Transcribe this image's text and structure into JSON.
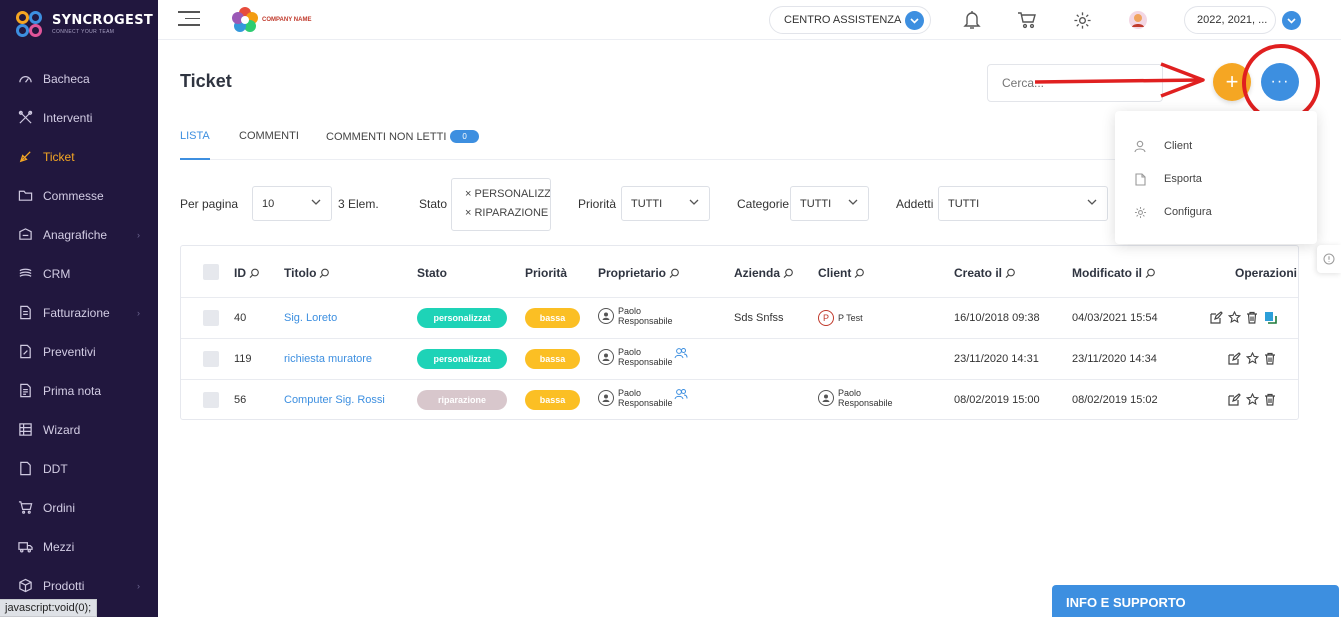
{
  "brand": {
    "name": "SYNCROGEST",
    "tagline": "CONNECT YOUR TEAM"
  },
  "sidebar": {
    "items": [
      {
        "label": "Bacheca",
        "icon": "gauge-icon"
      },
      {
        "label": "Interventi",
        "icon": "tools-icon"
      },
      {
        "label": "Ticket",
        "icon": "ticket-icon",
        "active": true
      },
      {
        "label": "Commesse",
        "icon": "folder-icon"
      },
      {
        "label": "Anagrafiche",
        "icon": "contacts-icon",
        "has_sub": true
      },
      {
        "label": "CRM",
        "icon": "crm-icon"
      },
      {
        "label": "Fatturazione",
        "icon": "invoice-icon",
        "has_sub": true
      },
      {
        "label": "Preventivi",
        "icon": "quote-icon"
      },
      {
        "label": "Prima nota",
        "icon": "notes-icon"
      },
      {
        "label": "Wizard",
        "icon": "wizard-icon"
      },
      {
        "label": "DDT",
        "icon": "ddt-icon"
      },
      {
        "label": "Ordini",
        "icon": "cart-icon"
      },
      {
        "label": "Mezzi",
        "icon": "truck-icon"
      },
      {
        "label": "Prodotti",
        "icon": "product-icon",
        "has_sub": true
      }
    ]
  },
  "statusbar": "javascript:void(0);",
  "topbar": {
    "company_logo_text": "COMPANY NAME",
    "assistance_label": "CENTRO ASSISTENZA",
    "year_label": "2022, 2021, ..."
  },
  "page": {
    "title": "Ticket",
    "search_placeholder": "Cerca...",
    "add_button": "+",
    "more_button": "···"
  },
  "tabs": [
    {
      "label": "LISTA",
      "active": true
    },
    {
      "label": "COMMENTI"
    },
    {
      "label": "COMMENTI NON LETTI",
      "badge": "0"
    }
  ],
  "filters": {
    "per_page_label": "Per pagina",
    "per_page_value": "10",
    "count_text": "3 Elem.",
    "stato_label": "Stato",
    "stato_chips": [
      "PERSONALIZZ",
      "RIPARAZIONE"
    ],
    "priorita_label": "Priorità",
    "priorita_value": "TUTTI",
    "categorie_label": "Categorie",
    "categorie_value": "TUTTI",
    "addetti_label": "Addetti",
    "addetti_value": "TUTTI"
  },
  "dropdown": {
    "items": [
      {
        "label": "Client",
        "icon": "user-icon"
      },
      {
        "label": "Esporta",
        "icon": "file-icon"
      },
      {
        "label": "Configura",
        "icon": "gear-icon"
      }
    ]
  },
  "table": {
    "headers": {
      "id": "ID",
      "titolo": "Titolo",
      "stato": "Stato",
      "priorita": "Priorità",
      "proprietario": "Proprietario",
      "azienda": "Azienda",
      "client": "Client",
      "creato": "Creato il",
      "modificato": "Modificato il",
      "operazioni": "Operazioni"
    },
    "rows": [
      {
        "id": "40",
        "titolo": "Sig. Loreto",
        "stato": "personalizzat",
        "priorita": "bassa",
        "owner_first": "Paolo",
        "owner_last": "Responsabile",
        "azienda": "Sds Snfss",
        "client": "P Test",
        "creato": "16/10/2018 09:38",
        "modificato": "04/03/2021 15:54"
      },
      {
        "id": "119",
        "titolo": "richiesta muratore",
        "stato": "personalizzat",
        "priorita": "bassa",
        "owner_first": "Paolo",
        "owner_last": "Responsabile",
        "azienda": "",
        "client": "",
        "creato": "23/11/2020 14:31",
        "modificato": "23/11/2020 14:34"
      },
      {
        "id": "56",
        "titolo": "Computer Sig. Rossi",
        "stato": "riparazione",
        "priorita": "bassa",
        "owner_first": "Paolo",
        "owner_last": "Responsabile",
        "azienda": "",
        "client_first": "Paolo",
        "client_last": "Responsabile",
        "creato": "08/02/2019 15:00",
        "modificato": "08/02/2019 15:02"
      }
    ]
  },
  "info_support": "INFO E SUPPORTO",
  "colors": {
    "sidebar_bg": "#21173e",
    "accent_orange": "#f5a623",
    "accent_blue": "#3d8fe0",
    "pill_personalizzat": "#1ed3b7",
    "pill_riparazione": "#d8c7cc",
    "pill_bassa": "#fbbf24",
    "annotation_red": "#e02020"
  }
}
